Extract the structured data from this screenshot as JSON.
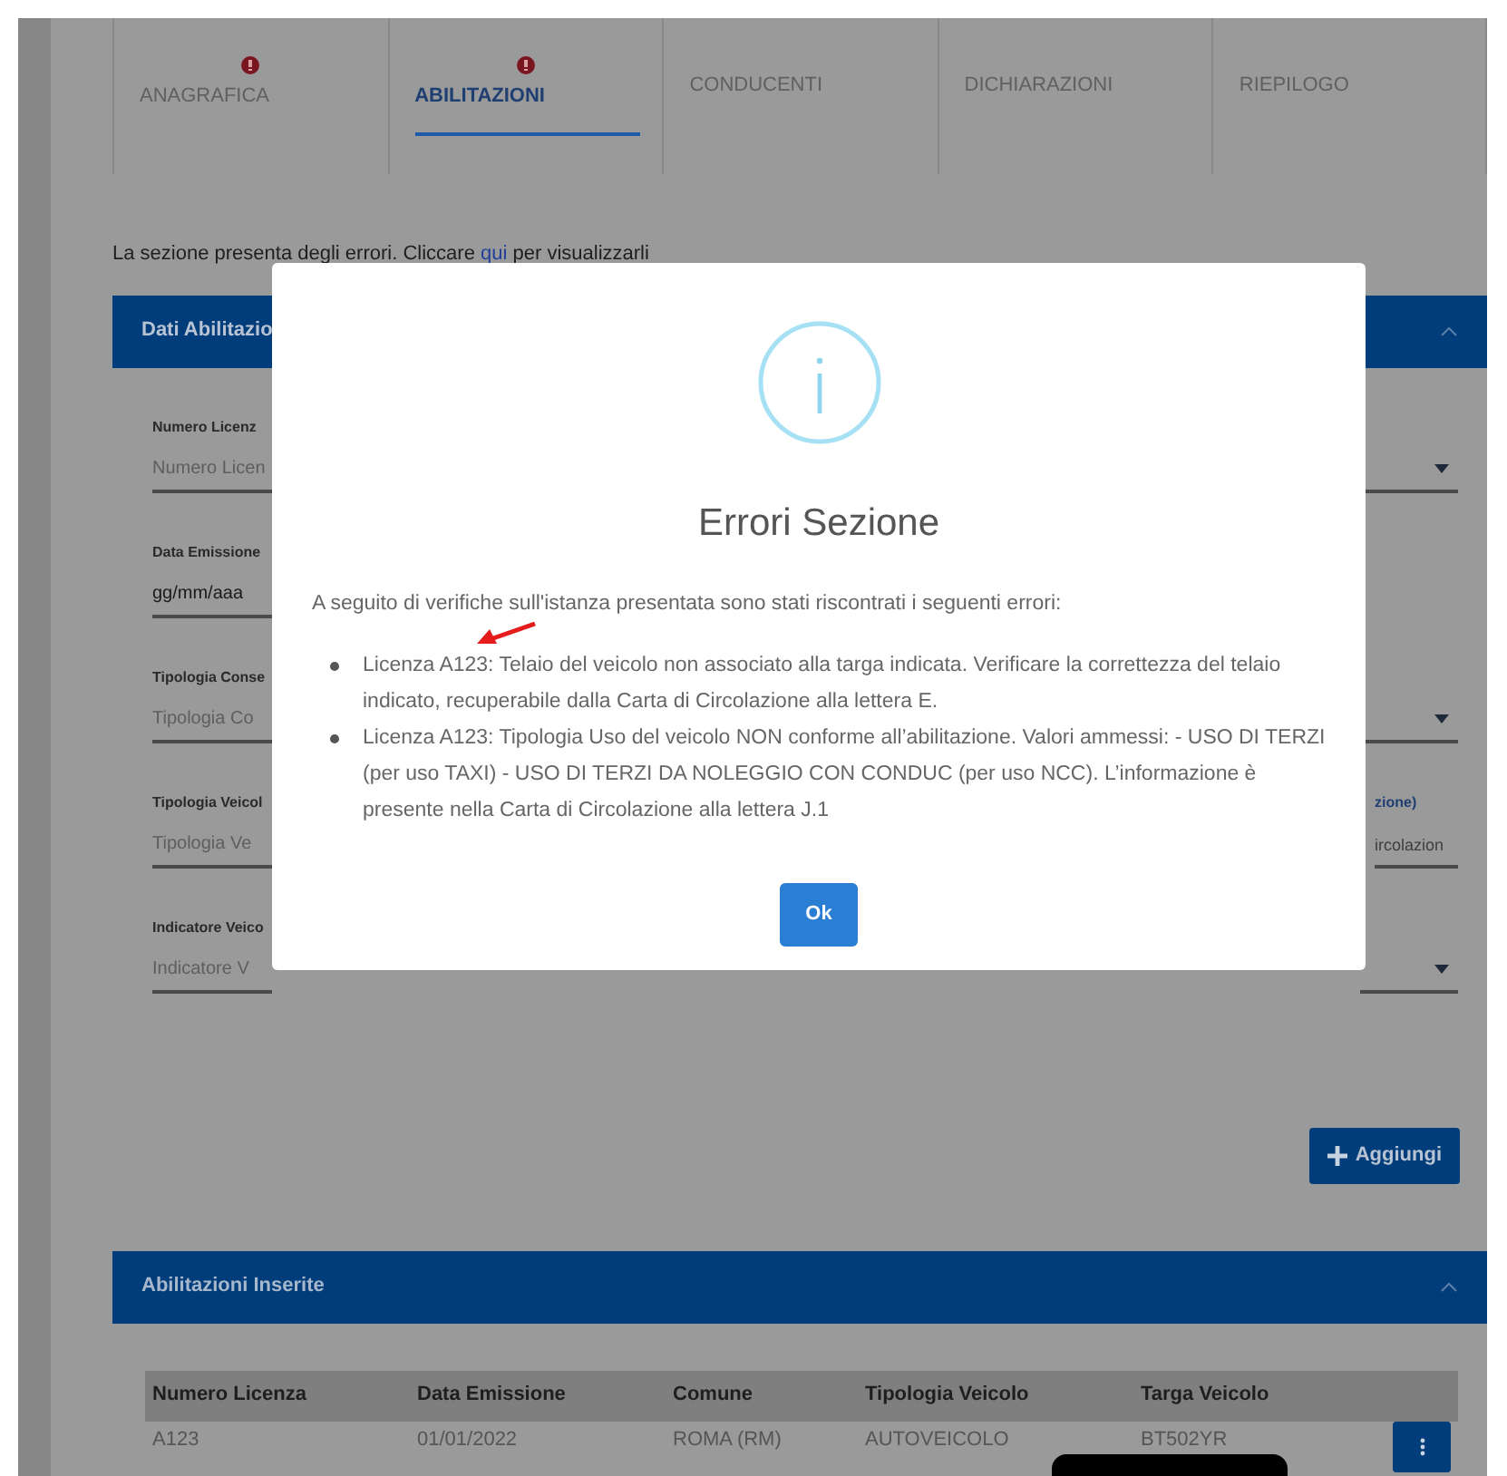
{
  "tabs": [
    {
      "label": "ANAGRAFICA",
      "selected": false,
      "error": true
    },
    {
      "label": "ABILITAZIONI",
      "selected": true,
      "error": true
    },
    {
      "label": "CONDUCENTI",
      "selected": false,
      "error": false
    },
    {
      "label": "DICHIARAZIONI",
      "selected": false,
      "error": false
    },
    {
      "label": "RIEPILOGO",
      "selected": false,
      "error": false
    }
  ],
  "error_notice": {
    "before": "La sezione presenta degli errori. Cliccare ",
    "link": "qui",
    "after": " per visualizzarli"
  },
  "section": {
    "title": "Dati Abilitazio",
    "expanded": true
  },
  "form_rows": [
    {
      "label": "Numero Licenz",
      "placeholder": "Numero Licen",
      "dropdown": true
    },
    {
      "label": "Data Emissione",
      "value": "gg/mm/aaa",
      "dropdown": false
    },
    {
      "label": "Tipologia Conse",
      "placeholder": "Tipologia Co",
      "dropdown": true
    },
    {
      "label": "Tipologia Veicol",
      "placeholder": "Tipologia Ve",
      "dropdown": false,
      "side": {
        "label": "zione)",
        "placeholder": "ircolazion"
      }
    },
    {
      "label": "Indicatore Veico",
      "placeholder": "Indicatore V",
      "dropdown": true
    }
  ],
  "add_button": {
    "label": "Aggiungi"
  },
  "list_section": {
    "title": "Abilitazioni Inserite",
    "expanded": true
  },
  "table": {
    "columns": [
      "Numero Licenza",
      "Data Emissione",
      "Comune",
      "Tipologia Veicolo",
      "Targa Veicolo"
    ],
    "rows": [
      [
        "A123",
        "01/01/2022",
        "ROMA (RM)",
        "AUTOVEICOLO",
        "BT502YR"
      ]
    ]
  },
  "modal": {
    "title": "Errori Sezione",
    "intro": "A seguito di verifiche sull'istanza presentata sono stati riscontrati i seguenti errori:",
    "errors": [
      "Licenza A123: Telaio del veicolo non associato alla targa indicata. Verificare la correttezza del telaio indicato, recuperabile dalla Carta di Circolazione alla lettera E.",
      "Licenza A123: Tipologia Uso del veicolo NON conforme all’abilitazione. Valori ammessi: - USO DI TERZI (per uso TAXI) - USO DI TERZI DA NOLEGGIO CON CONDUC (per uso NCC). L’informazione è presente nella Carta di Circolazione alla lettera J.1"
    ],
    "ok_label": "Ok"
  }
}
